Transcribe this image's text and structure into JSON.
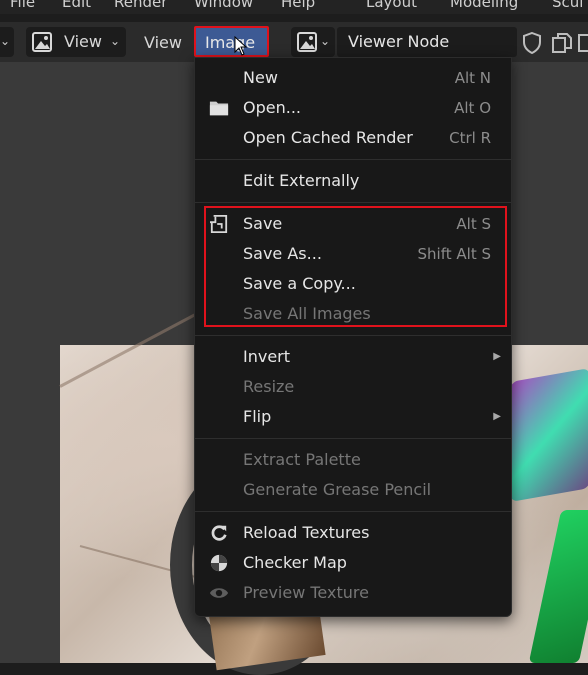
{
  "topbar": {
    "items": [
      "File",
      "Edit",
      "Render",
      "Window",
      "Help"
    ],
    "workspaces": [
      "Layout",
      "Modeling",
      "Scul"
    ]
  },
  "header": {
    "view_label": "View",
    "view_menu": "View",
    "image_menu": "Image",
    "node_name": "Viewer Node"
  },
  "menu": {
    "new": {
      "label": "New",
      "shortcut": "Alt N"
    },
    "open": {
      "label": "Open...",
      "shortcut": "Alt O"
    },
    "open_cached": {
      "label": "Open Cached Render",
      "shortcut": "Ctrl R"
    },
    "edit_externally": {
      "label": "Edit Externally"
    },
    "save": {
      "label": "Save",
      "shortcut": "Alt S"
    },
    "save_as": {
      "label": "Save As...",
      "shortcut": "Shift Alt S"
    },
    "save_copy": {
      "label": "Save a Copy..."
    },
    "save_all": {
      "label": "Save All Images"
    },
    "invert": {
      "label": "Invert"
    },
    "resize": {
      "label": "Resize"
    },
    "flip": {
      "label": "Flip"
    },
    "extract_palette": {
      "label": "Extract Palette"
    },
    "grease_pencil": {
      "label": "Generate Grease Pencil"
    },
    "reload": {
      "label": "Reload Textures"
    },
    "checker": {
      "label": "Checker Map"
    },
    "preview": {
      "label": "Preview Texture"
    }
  },
  "colors": {
    "accent": "#3d5a94",
    "highlight": "#e0121c"
  }
}
